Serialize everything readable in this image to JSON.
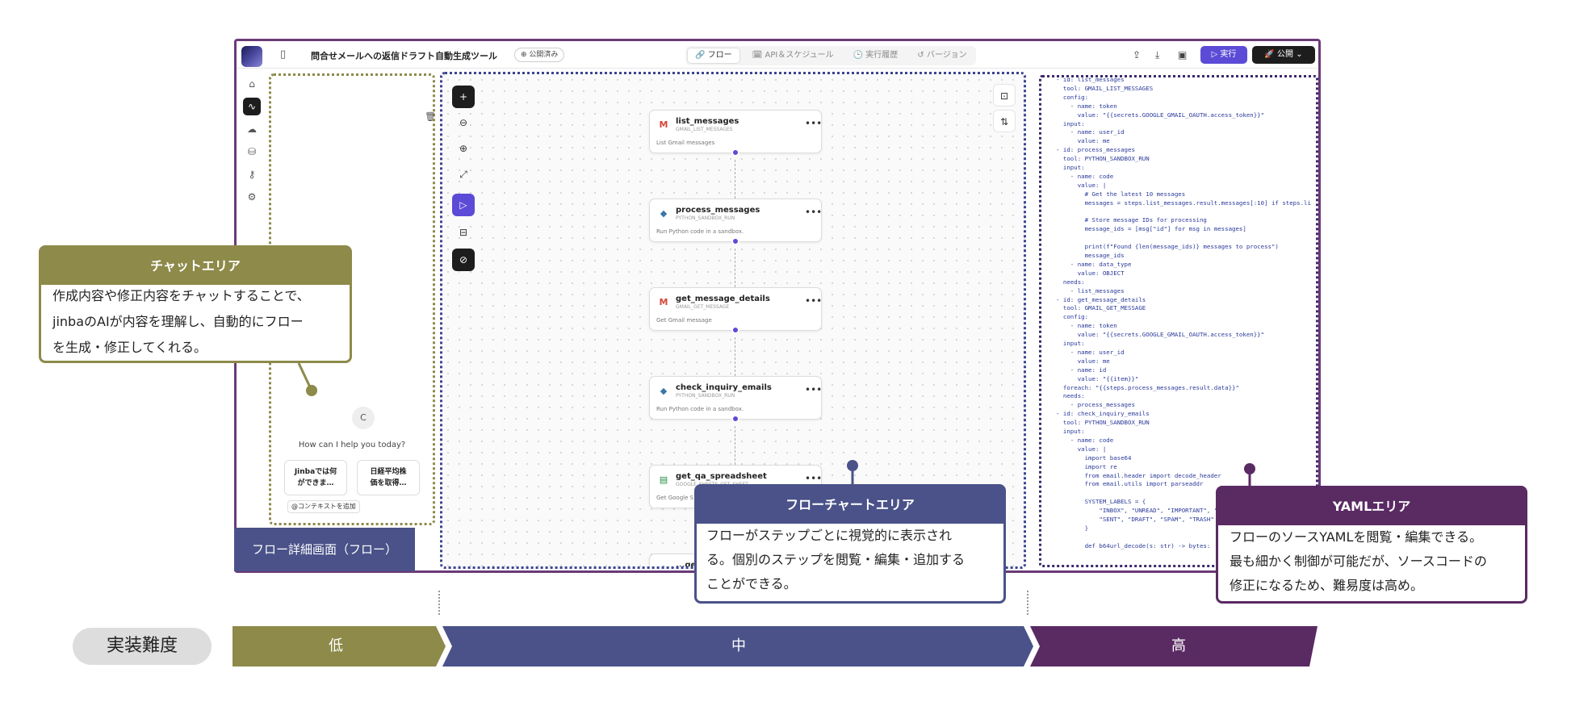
{
  "app": {
    "title": "問合せメールへの返信ドラフト自動生成ツール",
    "status_badge": "⊕ 公開済み",
    "tabs": [
      {
        "label": "🔗 フロー",
        "active": true
      },
      {
        "label": "🗓 API＆スケジュール",
        "active": false
      },
      {
        "label": "🕒 実行履歴",
        "active": false
      },
      {
        "label": "↺ バージョン",
        "active": false
      }
    ],
    "run_label": "▷ 実行",
    "publish_label": "🚀 公開  ⌄",
    "accent_color": "#5b4bd6"
  },
  "chat": {
    "avatar_initial": "C",
    "greeting": "How can I help you today?",
    "suggestions": [
      "Jinbaでは何\nができま…",
      "日経平均株\n価を取得…"
    ],
    "context_chip": "@コンテキストを追加"
  },
  "nodes": [
    {
      "name": "list_messages",
      "tool": "GMAIL_LIST_MESSAGES",
      "desc": "List Gmail messages",
      "icon": "gmail-icon"
    },
    {
      "name": "process_messages",
      "tool": "PYTHON_SANDBOX_RUN",
      "desc": "Run Python code in a sandbox.",
      "icon": "python-icon"
    },
    {
      "name": "get_message_details",
      "tool": "GMAIL_GET_MESSAGE",
      "desc": "Get Gmail message",
      "icon": "gmail-icon"
    },
    {
      "name": "check_inquiry_emails",
      "tool": "PYTHON_SANDBOX_RUN",
      "desc": "Run Python code in a sandbox.",
      "icon": "python-icon"
    },
    {
      "name": "get_qa_spreadsheet",
      "tool": "GOOGLE_SHEETS_GET_SHEET",
      "desc": "Get Google S",
      "icon": "sheets-icon"
    },
    {
      "name": "...gene...",
      "tool": "",
      "desc": "",
      "icon": "python-icon"
    }
  ],
  "yaml_lines": [
    "- id: list_messages",
    "  tool: GMAIL_LIST_MESSAGES",
    "  config:",
    "    - name: token",
    "      value: \"{{secrets.GOOGLE_GMAIL_OAUTH.access_token}}\"",
    "  input:",
    "    - name: user_id",
    "      value: me",
    "- id: process_messages",
    "  tool: PYTHON_SANDBOX_RUN",
    "  input:",
    "    - name: code",
    "      value: |",
    "        # Get the latest 10 messages",
    "        messages = steps.list_messages.result.messages[:10] if steps.li",
    "",
    "        # Store message IDs for processing",
    "        message_ids = [msg[\"id\"] for msg in messages]",
    "",
    "        print(f\"Found {len(message_ids)} messages to process\")",
    "        message_ids",
    "    - name: data_type",
    "      value: OBJECT",
    "  needs:",
    "    - list_messages",
    "- id: get_message_details",
    "  tool: GMAIL_GET_MESSAGE",
    "  config:",
    "    - name: token",
    "      value: \"{{secrets.GOOGLE_GMAIL_OAUTH.access_token}}\"",
    "  input:",
    "    - name: user_id",
    "      value: me",
    "    - name: id",
    "      value: \"{{item}}\"",
    "  foreach: \"{{steps.process_messages.result.data}}\"",
    "  needs:",
    "    - process_messages",
    "- id: check_inquiry_emails",
    "  tool: PYTHON_SANDBOX_RUN",
    "  input:",
    "    - name: code",
    "      value: |",
    "        import base64",
    "        import re",
    "        from email.header import decode_header",
    "        from email.utils import parseaddr",
    "",
    "        SYSTEM_LABELS = {",
    "            \"INBOX\", \"UNREAD\", \"IMPORTANT\", \"",
    "            \"SENT\", \"DRAFT\", \"SPAM\", \"TRASH\"",
    "        }",
    "",
    "        def b64url_decode(s: str) -> bytes:"
  ],
  "callouts": {
    "chat": {
      "title": "チャットエリア",
      "body": "作成内容や修正内容をチャットすることで、\njinbaのAIが内容を理解し、自動的にフロー\nを生成・修正してくれる。",
      "color": "#8d8a4a"
    },
    "flowchart": {
      "title": "フローチャートエリア",
      "body": "フローがステップごとに視覚的に表示され\nる。個別のステップを閲覧・編集・追加する\nことができる。",
      "color": "#4a5289"
    },
    "yaml": {
      "title": "YAMLエリア",
      "body": "フローのソースYAMLを閲覧・編集できる。\n最も細かく制御が可能だが、ソースコードの\n修正になるため、難易度は高め。",
      "color": "#5a2a63"
    }
  },
  "flow_tag": "フロー詳細画面（フロー）",
  "difficulty": {
    "label": "実装難度",
    "levels": [
      {
        "label": "低",
        "color": "#8d8a4a"
      },
      {
        "label": "中",
        "color": "#4a5289"
      },
      {
        "label": "高",
        "color": "#5a2a63"
      }
    ]
  }
}
